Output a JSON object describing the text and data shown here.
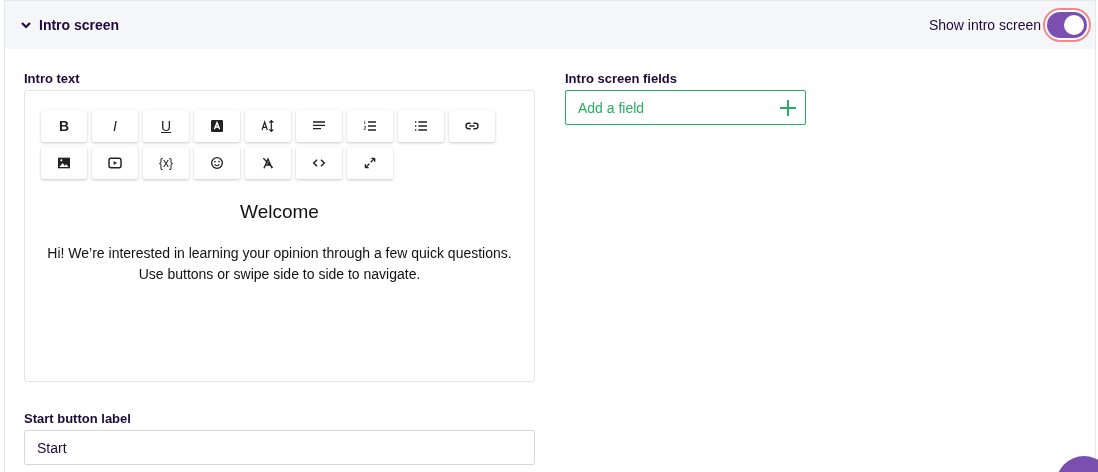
{
  "section": {
    "title": "Intro screen",
    "expanded": true,
    "toggle_label": "Show intro screen",
    "toggle_on": true
  },
  "intro_text": {
    "label": "Intro text",
    "toolbar": [
      {
        "kind": "bold",
        "label": "B"
      },
      {
        "kind": "italic",
        "label": "I"
      },
      {
        "kind": "underline",
        "label": "U"
      },
      {
        "kind": "color"
      },
      {
        "kind": "size"
      },
      {
        "kind": "align"
      },
      {
        "kind": "ordered"
      },
      {
        "kind": "bullets"
      },
      {
        "kind": "link"
      },
      {
        "kind": "image"
      },
      {
        "kind": "video"
      },
      {
        "kind": "variable",
        "label": "{x}"
      },
      {
        "kind": "emoji"
      },
      {
        "kind": "clear"
      },
      {
        "kind": "code"
      },
      {
        "kind": "expand"
      }
    ],
    "heading": "Welcome",
    "body": [
      "Hi! We’re interested in learning your opinion through a few quick questions.",
      "Use buttons or swipe side to side to navigate."
    ]
  },
  "start_button": {
    "label": "Start button label",
    "value": "Start"
  },
  "fields": {
    "label": "Intro screen fields",
    "add": "Add a field"
  }
}
